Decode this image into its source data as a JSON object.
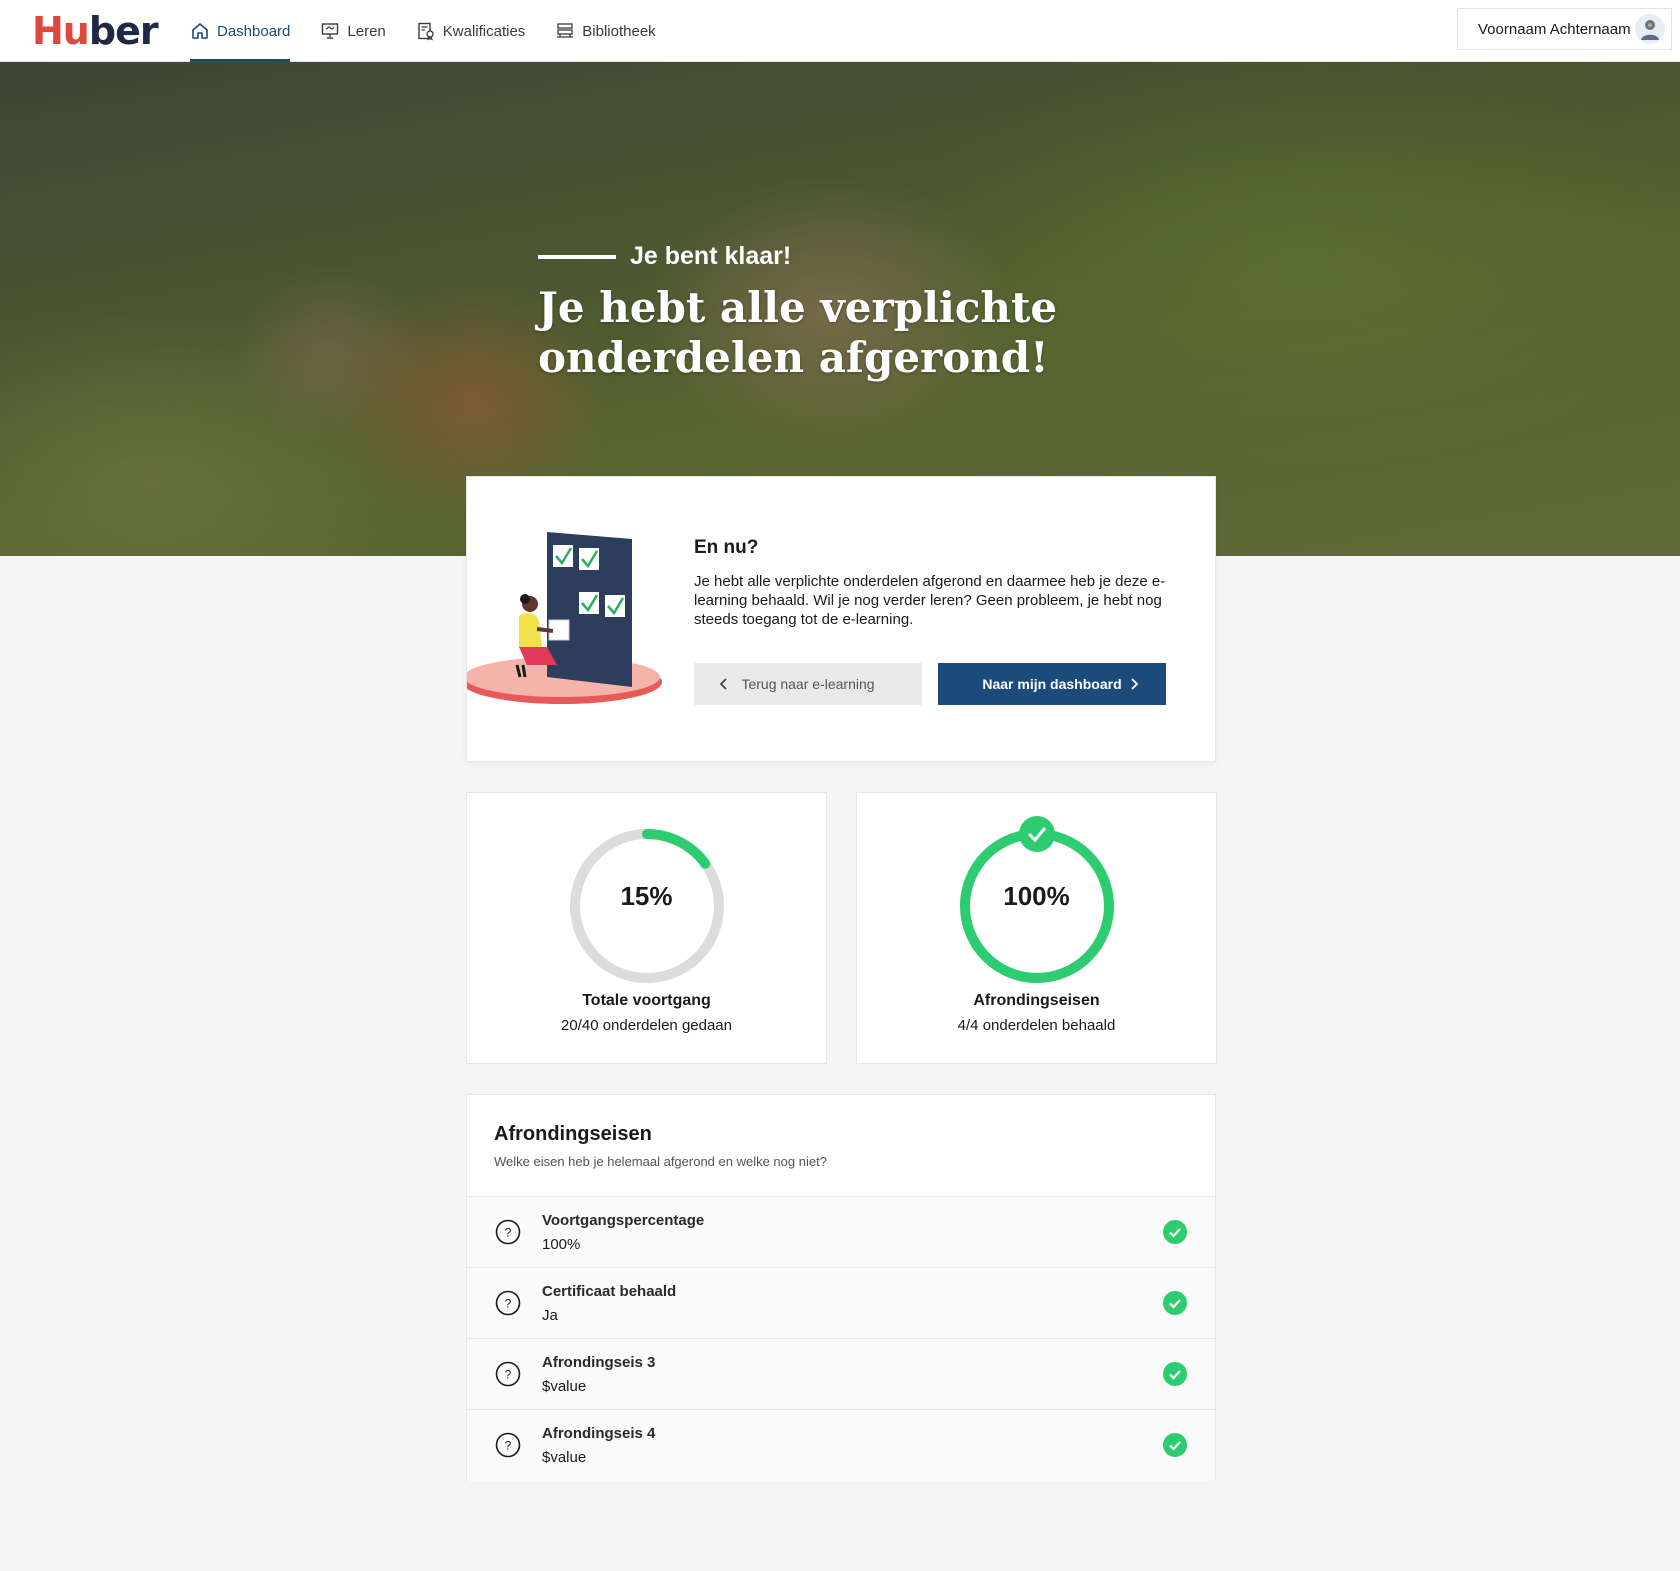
{
  "header": {
    "logo_first": "Hu",
    "logo_b": "b",
    "logo_rest": "er",
    "nav": [
      {
        "label": "Dashboard",
        "icon": "home-icon",
        "active": true
      },
      {
        "label": "Leren",
        "icon": "presentation-icon",
        "active": false
      },
      {
        "label": "Kwalificaties",
        "icon": "certificate-icon",
        "active": false
      },
      {
        "label": "Bibliotheek",
        "icon": "library-icon",
        "active": false
      }
    ],
    "user_name": "Voornaam Achternaam"
  },
  "hero": {
    "eyebrow": "Je bent klaar!",
    "title": "Je hebt alle verplichte onderdelen afgerond!"
  },
  "next": {
    "title": "En nu?",
    "text": "Je hebt alle verplichte onderdelen afgerond en daarmee heb je deze e-learning behaald. Wil je nog verder leren? Geen probleem, je hebt nog steeds toegang tot de e-learning.",
    "back_label": "Terug naar e-learning",
    "dashboard_label": "Naar mijn dashboard"
  },
  "progress": [
    {
      "value_text": "15%",
      "fraction": 0.15,
      "label": "Totale voortgang",
      "sub": "20/40 onderdelen gedaan",
      "complete": false
    },
    {
      "value_text": "100%",
      "fraction": 1.0,
      "label": "Afrondingseisen",
      "sub": "4/4 onderdelen behaald",
      "complete": true
    }
  ],
  "requirements": {
    "title": "Afrondingseisen",
    "subtitle": "Welke eisen heb je helemaal afgerond en welke nog niet?",
    "items": [
      {
        "name": "Voortgangspercentage",
        "value": "100%"
      },
      {
        "name": "Certificaat behaald",
        "value": "Ja"
      },
      {
        "name": "Afrondingseis 3",
        "value": "$value"
      },
      {
        "name": "Afrondingseis 4",
        "value": "$value"
      }
    ]
  },
  "colors": {
    "primary": "#1a4b7a",
    "success": "#2ecc71",
    "brand_red": "#e0483e",
    "ring_track": "#dcdcdc"
  }
}
